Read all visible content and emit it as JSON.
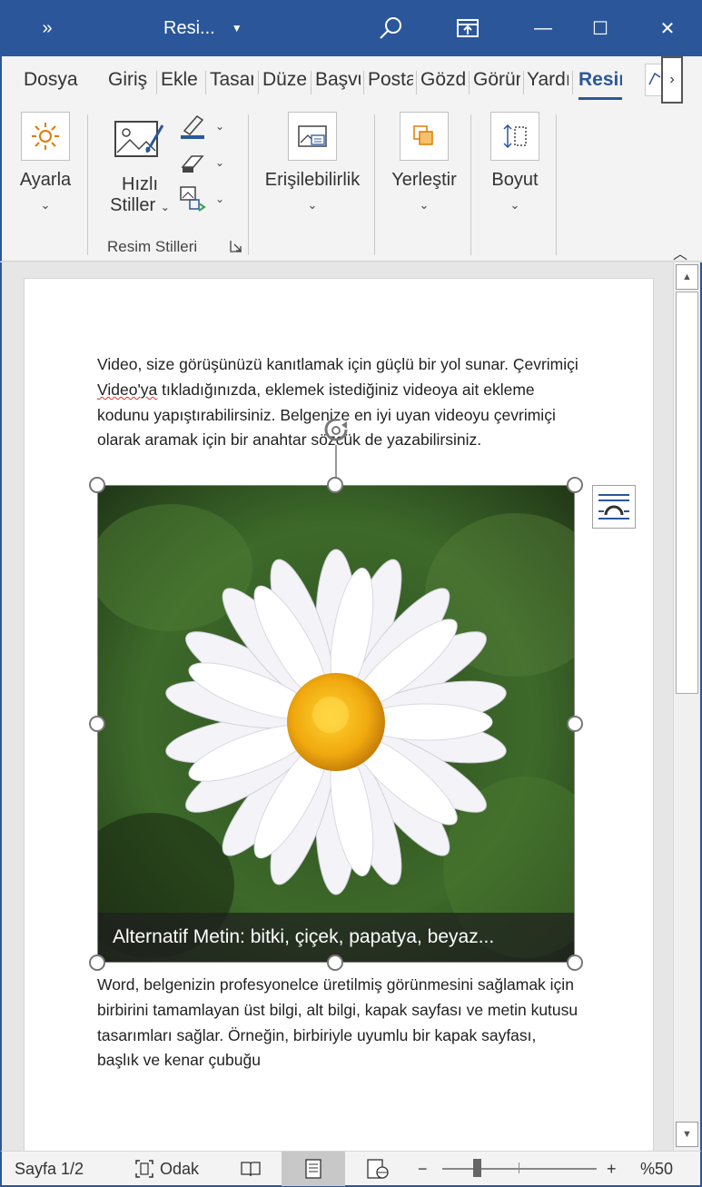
{
  "titlebar": {
    "more": "»",
    "title": "Resi...",
    "caret": "▼",
    "search_icon": "search-icon",
    "share_icon": "share-icon",
    "minimize": "—",
    "maximize": "☐",
    "close": "✕"
  },
  "tabs": [
    {
      "label": "Dosya",
      "active": false
    },
    {
      "label": "Giriş",
      "active": false
    },
    {
      "label": "Ekle",
      "active": false
    },
    {
      "label": "Tasarım",
      "active": false
    },
    {
      "label": "Düzen",
      "active": false
    },
    {
      "label": "Başvurular",
      "active": false
    },
    {
      "label": "Postalar",
      "active": false
    },
    {
      "label": "Gözden",
      "active": false
    },
    {
      "label": "Görünüm",
      "active": false
    },
    {
      "label": "Yardım",
      "active": false
    },
    {
      "label": "Resim",
      "active": true
    }
  ],
  "tab_scroll": "›",
  "ribbon": {
    "adjust": {
      "label": "Ayarla",
      "icon": "sun-icon"
    },
    "quick_styles": {
      "label_line1": "Hızlı",
      "label_line2": "Stiller",
      "icon": "picture-brush-icon"
    },
    "picture_styles_group": "Resim Stilleri",
    "accessibility": {
      "label": "Erişilebilirlik",
      "icon": "alt-text-icon"
    },
    "arrange": {
      "label": "Yerleştir",
      "icon": "arrange-icon"
    },
    "size": {
      "label": "Boyut",
      "icon": "size-icon"
    },
    "chevron": "⌄",
    "collapse": "︿"
  },
  "document": {
    "para1_a": "Video, size görüşünüzü kanıtlamak için güçlü bir yol sunar. Çevrimiçi ",
    "para1_squiggle": "Video'ya",
    "para1_b": " tıkladığınızda, eklemek istediğiniz videoya ait ekleme kodunu yapıştırabilirsiniz. Belgenize en iyi uyan videoyu çevrimiçi olarak aramak için bir anahtar sözcük de yazabilirsiniz.",
    "alt_text": "Alternatif Metin: bitki, çiçek, papatya, beyaz...",
    "para2": "Word, belgenizin profesyonelce üretilmiş görünmesini sağlamak için birbirini tamamlayan üst bilgi, alt bilgi, kapak sayfası ve metin kutusu tasarımları sağlar. Örneğin, birbiriyle uyumlu bir kapak sayfası, başlık ve kenar çubuğu"
  },
  "statusbar": {
    "page": "Sayfa 1/2",
    "focus": "Odak",
    "zoom_minus": "−",
    "zoom_plus": "+",
    "zoom_level": "%50"
  },
  "colors": {
    "accent": "#2b579a"
  }
}
